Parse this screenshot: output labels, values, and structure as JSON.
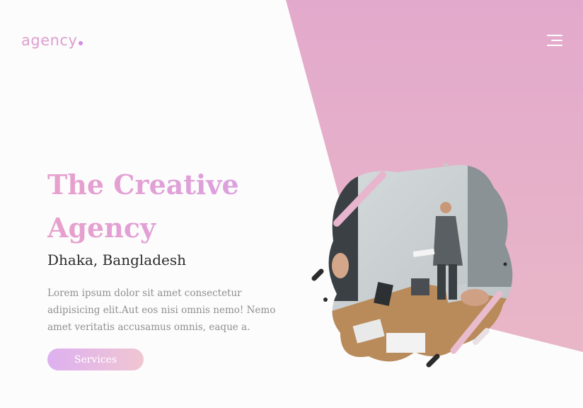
{
  "header": {
    "logo_text": "agency",
    "menu_icon": "hamburger-menu-icon"
  },
  "hero": {
    "title": "The Creative Agency",
    "subtitle": "Dhaka, Bangladesh",
    "description": "Lorem ipsum dolor sit amet consectetur adipisicing elit.Aut eos nisi omnis nemo! Nemo amet veritatis accusamus omnis, eaque a.",
    "button_label": "Services"
  },
  "colors": {
    "accent_pink": "#e3a9cc",
    "accent_purple": "#d9a0e2",
    "background": "#fcfcfc"
  }
}
